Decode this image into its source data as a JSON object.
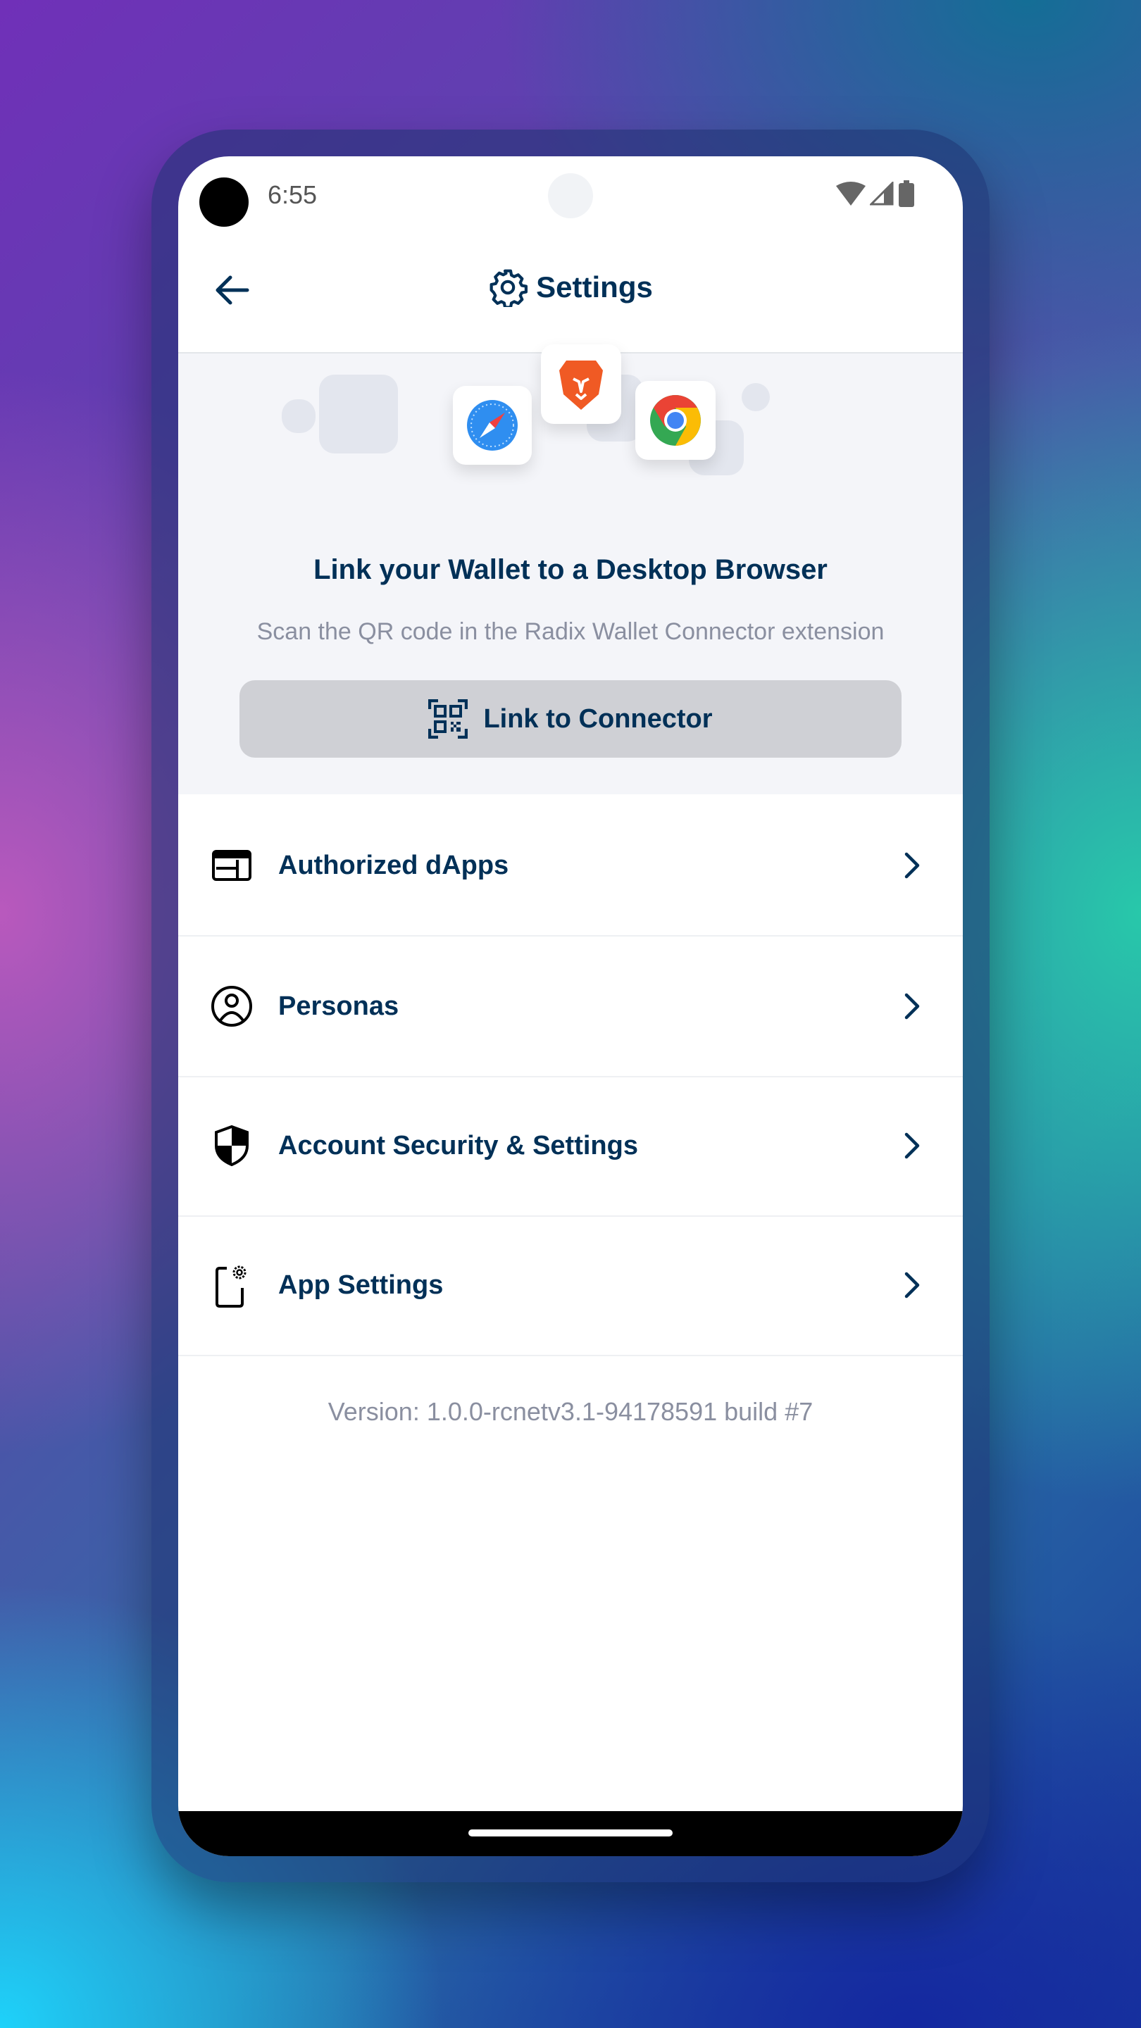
{
  "status_bar": {
    "time": "6:55",
    "icons": [
      "wifi-icon",
      "cellular-signal-icon",
      "battery-icon"
    ]
  },
  "header": {
    "title": "Settings",
    "back_icon": "arrow-left-icon",
    "title_icon": "gear-icon"
  },
  "banner": {
    "browser_icons": [
      "safari-icon",
      "brave-icon",
      "chrome-icon"
    ],
    "title": "Link your Wallet to a Desktop Browser",
    "subtitle": "Scan the QR code in the Radix Wallet Connector extension",
    "button_label": "Link to Connector",
    "button_icon": "qr-code-icon"
  },
  "menu": {
    "items": [
      {
        "label": "Authorized dApps",
        "icon": "dapps-icon"
      },
      {
        "label": "Personas",
        "icon": "persona-icon"
      },
      {
        "label": "Account Security & Settings",
        "icon": "shield-icon"
      },
      {
        "label": "App Settings",
        "icon": "phone-gear-icon"
      }
    ]
  },
  "version": "Version: 1.0.0-rcnetv3.1-94178591 build #7",
  "colors": {
    "text_primary": "#003057",
    "text_secondary": "#8a8fa0",
    "banner_bg": "#f4f5f9",
    "button_bg": "#cfd0d5"
  }
}
